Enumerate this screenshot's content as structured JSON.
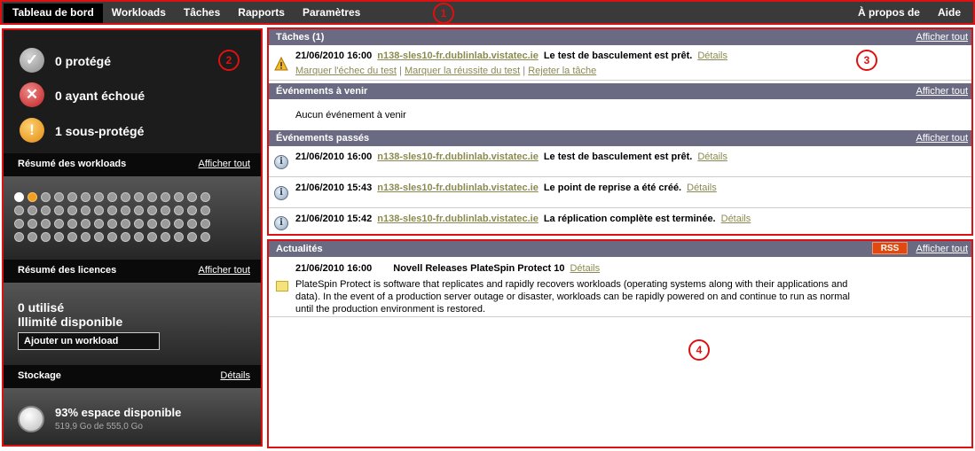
{
  "nav": {
    "items": [
      "Tableau de bord",
      "Workloads",
      "Tâches",
      "Rapports",
      "Paramètres"
    ],
    "right": [
      "À propos de",
      "Aide"
    ]
  },
  "callouts": [
    "1",
    "2",
    "3",
    "4"
  ],
  "left": {
    "statuses": [
      {
        "icon": "check-icon",
        "glyph": "✓",
        "label": "0 protégé"
      },
      {
        "icon": "error-icon",
        "glyph": "✕",
        "label": "0 ayant échoué"
      },
      {
        "icon": "warning-icon",
        "glyph": "!",
        "label": "1 sous-protégé"
      }
    ],
    "workloads": {
      "title": "Résumé des workloads",
      "link": "Afficher tout"
    },
    "licenses": {
      "title": "Résumé des licences",
      "link": "Afficher tout",
      "used": "0 utilisé",
      "available": "Illimité disponible",
      "button": "Ajouter un workload"
    },
    "storage": {
      "title": "Stockage",
      "link": "Détails",
      "free": "93% espace disponible",
      "detail": "519,9 Go de 555,0 Go"
    }
  },
  "tasks": {
    "title": "Tâches (1)",
    "link": "Afficher tout",
    "item": {
      "date": "21/06/2010 16:00",
      "server": "n138-sles10-fr.dublinlab.vistatec.ie",
      "message": "Le test de basculement est prêt.",
      "details": "Détails"
    },
    "actions": [
      "Marquer l'échec du test",
      "Marquer la réussite du test",
      "Rejeter la tâche"
    ],
    "separator": "|"
  },
  "upcoming": {
    "title": "Événements à venir",
    "link": "Afficher tout",
    "empty": "Aucun événement à venir"
  },
  "past": {
    "title": "Événements passés",
    "link": "Afficher tout",
    "items": [
      {
        "date": "21/06/2010 16:00",
        "server": "n138-sles10-fr.dublinlab.vistatec.ie",
        "message": "Le test de basculement est prêt.",
        "details": "Détails"
      },
      {
        "date": "21/06/2010 15:43",
        "server": "n138-sles10-fr.dublinlab.vistatec.ie",
        "message": "Le point de reprise a été créé.",
        "details": "Détails"
      },
      {
        "date": "21/06/2010 15:42",
        "server": "n138-sles10-fr.dublinlab.vistatec.ie",
        "message": "La réplication complète est terminée.",
        "details": "Détails"
      }
    ]
  },
  "news": {
    "title": "Actualités",
    "rss": "RSS",
    "link": "Afficher tout",
    "item": {
      "date": "21/06/2010 16:00",
      "headline": "Novell Releases PlateSpin Protect 10",
      "details": "Détails",
      "body": "PlateSpin Protect is software that replicates and rapidly recovers workloads (operating systems along with their applications and data). In the event of a production server outage or disaster, workloads can be rapidly powered on and continue to run as normal until the production environment is restored."
    }
  }
}
